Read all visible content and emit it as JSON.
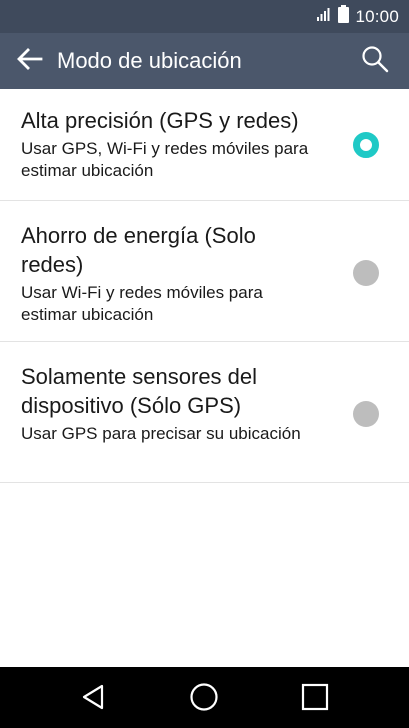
{
  "status_bar": {
    "time": "10:00",
    "icons": [
      "signal-icon",
      "battery-icon"
    ]
  },
  "app_bar": {
    "title": "Modo de ubicación",
    "back_icon": "back-arrow-icon",
    "search_icon": "search-icon"
  },
  "options": [
    {
      "title": "Alta precisión (GPS y redes)",
      "subtitle": "Usar GPS, Wi-Fi y redes móviles para estimar ubicación",
      "selected": true
    },
    {
      "title": "Ahorro de energía (Solo redes)",
      "subtitle": "Usar Wi-Fi y redes móviles para estimar ubicación",
      "selected": false
    },
    {
      "title": "Solamente sensores del dispositivo (Sólo GPS)",
      "subtitle": "Usar GPS para precisar su ubicación",
      "selected": false
    }
  ],
  "nav_bar": {
    "icons": [
      "back-triangle-icon",
      "home-circle-icon",
      "recents-square-icon"
    ]
  },
  "colors": {
    "status_bar_bg": "#3f4a5c",
    "app_bar_bg": "#4b576b",
    "accent": "#1fc9c6",
    "radio_unselected": "#bdbdbd",
    "nav_bar_bg": "#000000"
  }
}
